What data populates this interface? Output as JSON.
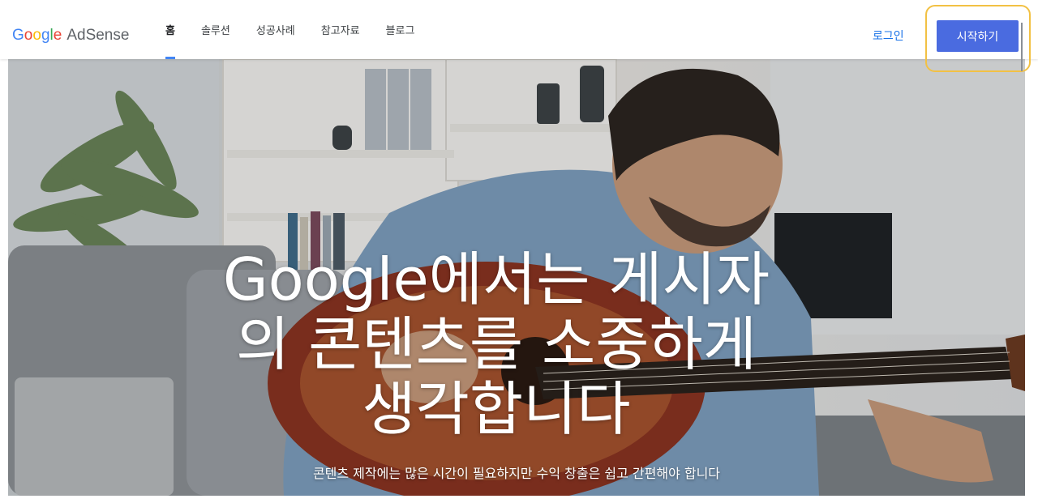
{
  "header": {
    "logo": {
      "google": "Google",
      "product": "AdSense"
    },
    "nav": [
      {
        "label": "홈",
        "active": true
      },
      {
        "label": "솔루션",
        "active": false
      },
      {
        "label": "성공사례",
        "active": false
      },
      {
        "label": "참고자료",
        "active": false
      },
      {
        "label": "블로그",
        "active": false
      }
    ],
    "login_label": "로그인",
    "cta_label": "시작하기"
  },
  "hero": {
    "headline": "Google에서는 게시자의 콘텐츠를 소중하게 생각합니다",
    "subtext": "콘텐츠 제작에는 많은 시간이 필요하지만 수익 창출은 쉽고 간편해야 합니다",
    "image_subject": "man-playing-acoustic-guitar-on-sofa"
  },
  "colors": {
    "accent_blue": "#4285F4",
    "cta_blue": "#4a6be0",
    "link_blue": "#1a73e8",
    "highlight_yellow": "#f2c144"
  }
}
